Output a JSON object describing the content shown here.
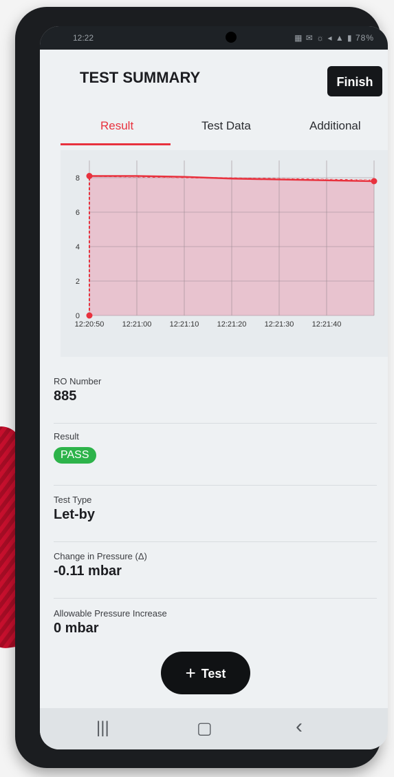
{
  "status_bar": {
    "time": "12:22",
    "icons": "▦ ✉ ☼ ◂ ▲ ▮ 78%"
  },
  "header": {
    "title": "TEST SUMMARY",
    "finish_label": "Finish"
  },
  "tabs": [
    {
      "label": "Result",
      "active": true
    },
    {
      "label": "Test Data",
      "active": false
    },
    {
      "label": "Additional",
      "active": false
    }
  ],
  "chart_data": {
    "type": "line",
    "x": [
      "12:20:50",
      "12:21:00",
      "12:21:10",
      "12:21:20",
      "12:21:30",
      "12:21:40",
      "12:21:48"
    ],
    "xtick_labels": [
      "12:20:50",
      "12:21:00",
      "12:21:10",
      "12:21:20",
      "12:21:30",
      "12:21:40"
    ],
    "yticks": [
      0,
      2,
      4,
      6,
      8
    ],
    "ylim": [
      0,
      8.6
    ],
    "series": [
      {
        "values": [
          8.1,
          8.1,
          8.05,
          7.95,
          7.9,
          7.85,
          7.8
        ]
      }
    ],
    "reference_line": {
      "start": [
        0,
        0
      ],
      "rise_to": 8.1,
      "end_value": 7.85
    },
    "area_color": "#e8c3cf",
    "line_color": "#e8323e",
    "grid": true
  },
  "details": [
    {
      "label": "RO Number",
      "value": "885"
    },
    {
      "label": "Result",
      "badge": "PASS"
    },
    {
      "label": "Test Type",
      "value": "Let-by"
    },
    {
      "label": "Change in Pressure (Δ)",
      "value": "-0.11 mbar"
    },
    {
      "label": "Allowable Pressure Increase",
      "value": "0 mbar"
    }
  ],
  "fab": {
    "icon": "plus-icon",
    "label": "Test"
  },
  "navbar": {
    "recents": "|||",
    "home": "▢",
    "back": "‹"
  },
  "colors": {
    "accent": "#e8323e",
    "pass": "#2db34a",
    "dark": "#15171a"
  }
}
